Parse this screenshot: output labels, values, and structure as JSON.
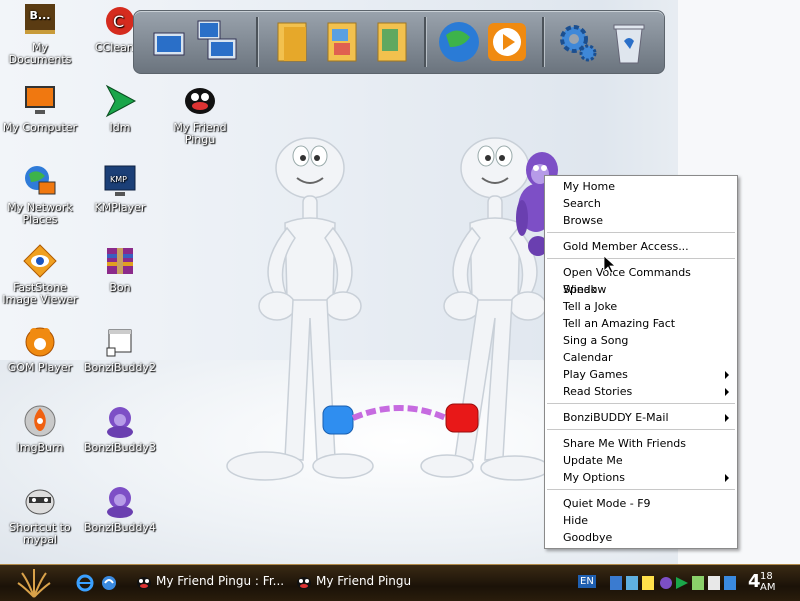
{
  "desktop_icons": [
    {
      "label": "My Documents",
      "icon": "folder-documents-icon"
    },
    {
      "label": "CCleaner",
      "icon": "ccleaner-icon"
    },
    {
      "label": "My Computer",
      "icon": "monitor-icon"
    },
    {
      "label": "Idm",
      "icon": "download-arrow-icon"
    },
    {
      "label": "My Friend Pingu",
      "icon": "penguin-icon"
    },
    {
      "label": "My Network Places",
      "icon": "network-globe-icon"
    },
    {
      "label": "KMPlayer",
      "icon": "media-player-icon"
    },
    {
      "label": "FastStone Image Viewer",
      "icon": "eye-icon"
    },
    {
      "label": "Bon",
      "icon": "archive-icon"
    },
    {
      "label": "GOM Player",
      "icon": "gom-icon"
    },
    {
      "label": "BonziBuddy2",
      "icon": "window-shortcut-icon"
    },
    {
      "label": "ImgBurn",
      "icon": "disc-flame-icon"
    },
    {
      "label": "BonziBuddy3",
      "icon": "purple-ape-icon"
    },
    {
      "label": "Shortcut to mypal",
      "icon": "raccoon-icon"
    },
    {
      "label": "BonziBuddy4",
      "icon": "purple-ape-icon"
    }
  ],
  "documents_badge": "B...",
  "dock_items": [
    "network-computers-icon",
    "folder-icon",
    "folder-images-icon",
    "folder-files-icon",
    "globe-icon",
    "media-play-icon",
    "settings-gears-icon",
    "recycle-bin-icon"
  ],
  "context_menu": {
    "groups": [
      [
        "My Home",
        "Search",
        "Browse"
      ],
      [
        "Gold Member Access..."
      ],
      [
        "Open Voice Commands Window",
        "Speak",
        "Tell a Joke",
        "Tell an Amazing Fact",
        "Sing a Song",
        "Calendar",
        "Play Games",
        "Read Stories"
      ],
      [
        "BonziBUDDY E-Mail"
      ],
      [
        "Share Me With Friends",
        "Update Me",
        "My Options"
      ],
      [
        "Quiet Mode - F9",
        "Hide",
        "Goodbye"
      ]
    ],
    "submenu_items": [
      "Play Games",
      "Read Stories",
      "BonziBUDDY E-Mail",
      "My Options"
    ]
  },
  "taskbar": {
    "tasks": [
      "My Friend Pingu : Fr...",
      "My Friend Pingu"
    ],
    "language": "EN",
    "clock_hour": "4",
    "clock_minute": "18",
    "clock_ampm": "AM"
  },
  "colors": {
    "taskbar": "#1b1208",
    "handcuff_left": "#2f8ef0",
    "handcuff_right": "#e81818",
    "chain": "#c66be0",
    "bonzi": "#7d4fc6"
  }
}
